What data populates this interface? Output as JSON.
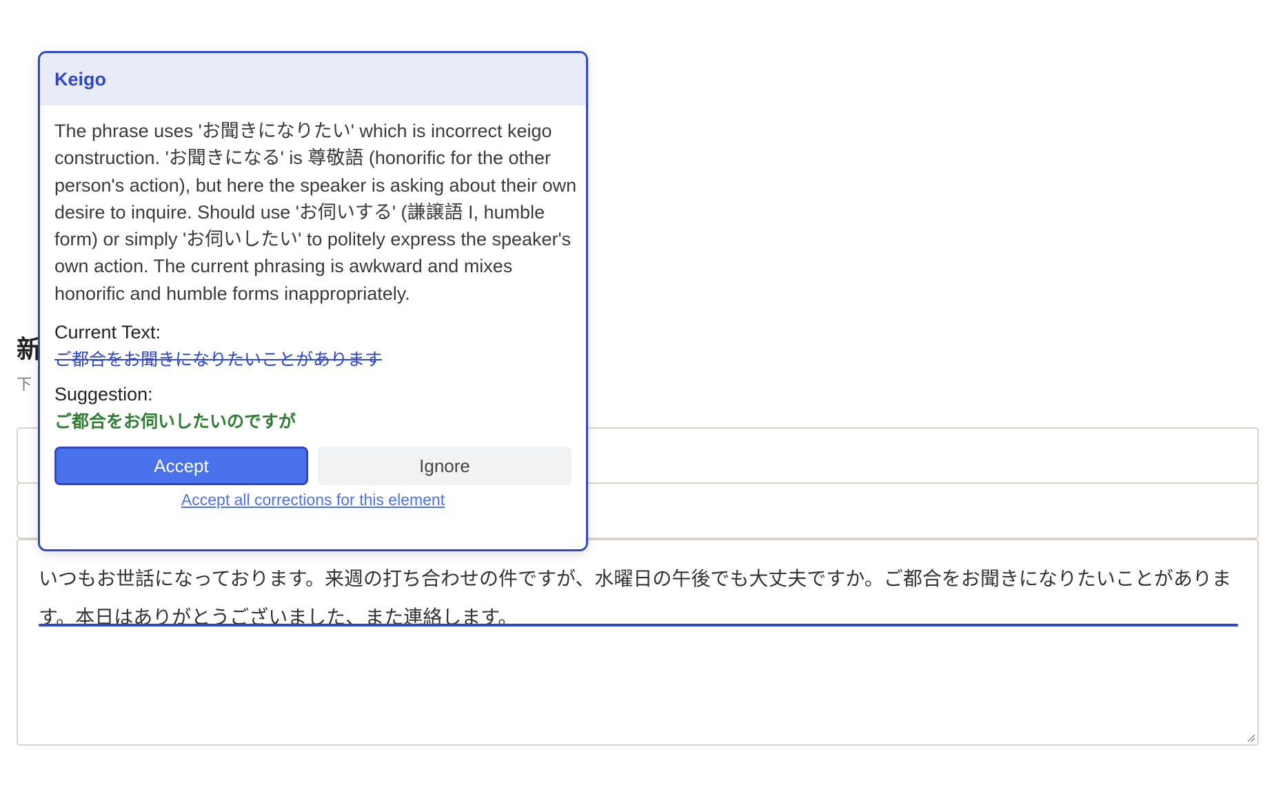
{
  "page": {
    "heading_partial": "新",
    "subtext_partial": "下",
    "body_text": "いつもお世話になっております。来週の打ち合わせの件ですが、水曜日の午後でも大丈夫ですか。ご都合をお聞きになりたいことがあります。本日はありがとうございました、また連絡します。"
  },
  "popover": {
    "title": "Keigo",
    "explanation": "The phrase uses 'お聞きになりたい' which is incorrect keigo construction. 'お聞きになる' is 尊敬語 (honorific for the other person's action), but here the speaker is asking about their own desire to inquire. Should use 'お伺いする' (謙譲語 I, humble form) or simply 'お伺いしたい' to politely express the speaker's own action. The current phrasing is awkward and mixes honorific and humble forms inappropriately.",
    "current_label": "Current Text:",
    "current_text": "ご都合をお聞きになりたいことがあります",
    "suggestion_label": "Suggestion:",
    "suggestion_text": "ご都合をお伺いしたいのですが",
    "accept_label": "Accept",
    "ignore_label": "Ignore",
    "accept_all_label": "Accept all corrections for this element"
  },
  "colors": {
    "accent": "#2f46c6",
    "accept_button": "#4a72ea",
    "suggestion": "#2e7d32",
    "header_bg": "#e8ebf8"
  },
  "icons": {
    "resize": "resize-grip-icon"
  }
}
